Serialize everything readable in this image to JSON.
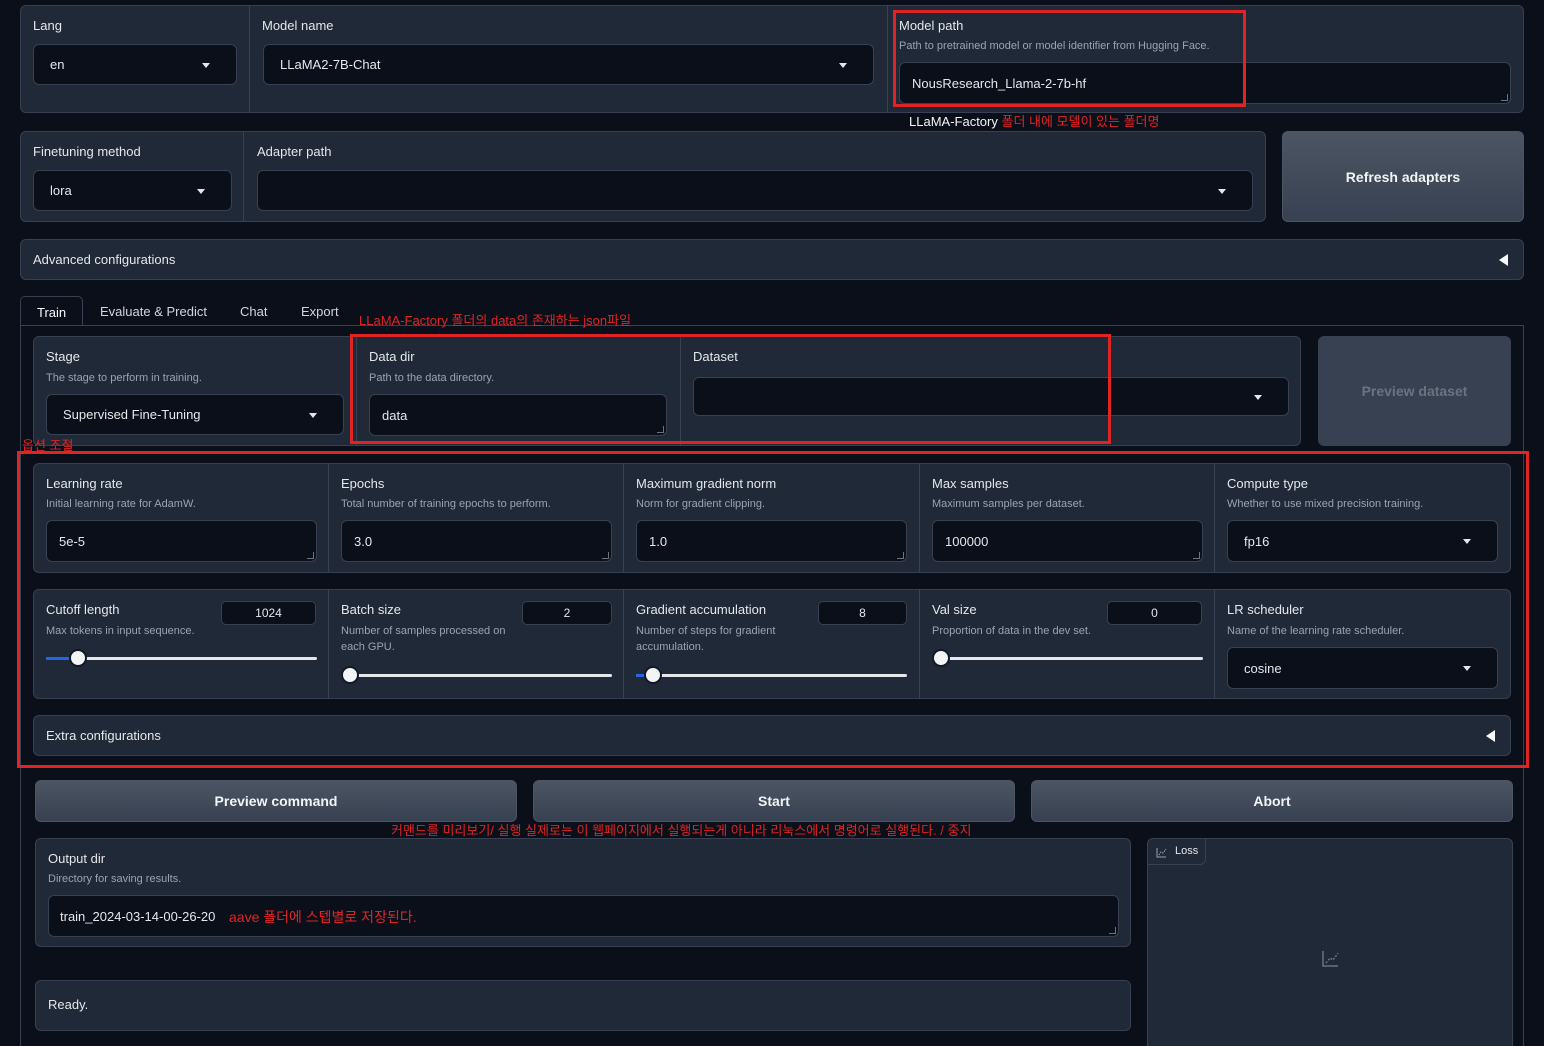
{
  "top": {
    "lang": {
      "label": "Lang",
      "value": "en"
    },
    "model_name": {
      "label": "Model name",
      "value": "LLaMA2-7B-Chat"
    },
    "model_path": {
      "label": "Model path",
      "info": "Path to pretrained model or model identifier from Hugging Face.",
      "value": "NousResearch_Llama-2-7b-hf"
    }
  },
  "row2": {
    "finetuning": {
      "label": "Finetuning method",
      "value": "lora"
    },
    "adapter": {
      "label": "Adapter path",
      "value": ""
    },
    "refresh_label": "Refresh adapters"
  },
  "advanced_label": "Advanced configurations",
  "tabs": [
    "Train",
    "Evaluate & Predict",
    "Chat",
    "Export"
  ],
  "train": {
    "stage": {
      "label": "Stage",
      "info": "The stage to perform in training.",
      "value": "Supervised Fine-Tuning"
    },
    "data_dir": {
      "label": "Data dir",
      "info": "Path to the data directory.",
      "value": "data"
    },
    "dataset": {
      "label": "Dataset",
      "value": ""
    },
    "preview_dataset_label": "Preview dataset",
    "learning_rate": {
      "label": "Learning rate",
      "info": "Initial learning rate for AdamW.",
      "value": "5e-5"
    },
    "epochs": {
      "label": "Epochs",
      "info": "Total number of training epochs to perform.",
      "value": "3.0"
    },
    "max_grad_norm": {
      "label": "Maximum gradient norm",
      "info": "Norm for gradient clipping.",
      "value": "1.0"
    },
    "max_samples": {
      "label": "Max samples",
      "info": "Maximum samples per dataset.",
      "value": "100000"
    },
    "compute_type": {
      "label": "Compute type",
      "info": "Whether to use mixed precision training.",
      "value": "fp16"
    },
    "cutoff_len": {
      "label": "Cutoff length",
      "info": "Max tokens in input sequence.",
      "value": "1024",
      "fraction": 0.09
    },
    "batch_size": {
      "label": "Batch size",
      "info1": "Number of samples processed on",
      "info2": "each GPU.",
      "value": "2",
      "fraction": 0.0
    },
    "grad_accum": {
      "label": "Gradient accumulation",
      "info1": "Number of steps for gradient",
      "info2": "accumulation.",
      "value": "8",
      "fraction": 0.03
    },
    "val_size": {
      "label": "Val size",
      "info": "Proportion of data in the dev set.",
      "value": "0",
      "fraction": 0.0
    },
    "lr_scheduler": {
      "label": "LR scheduler",
      "info": "Name of the learning rate scheduler.",
      "value": "cosine"
    },
    "extra_label": "Extra configurations",
    "preview_command_label": "Preview command",
    "start_label": "Start",
    "abort_label": "Abort",
    "output_dir": {
      "label": "Output dir",
      "info": "Directory for saving results.",
      "value": "train_2024-03-14-00-26-20"
    },
    "status": "Ready.",
    "loss_label": "Loss"
  },
  "annotations": {
    "model_path_note_prefix": "LLaMA-Factory",
    "model_path_note": " 폴더 내에 모델이 있는 폴더명",
    "data_note": "LLaMA-Factory 폴더의 data의 존재하는 json파일",
    "options_note": "옵션 조절",
    "command_note": "커맨드를 미리보기/ 실행 실제로는 이 웹페이지에서 실행되는게 아니라  리눅스에서 명령어로 실행된다. / 중지",
    "output_note": "aave 폴더에 스텝별로 저장된다."
  },
  "colors": {
    "accent_red": "#e02424",
    "slider_blue": "#2563eb",
    "panel": "#1f2937",
    "background": "#0b0f19"
  }
}
